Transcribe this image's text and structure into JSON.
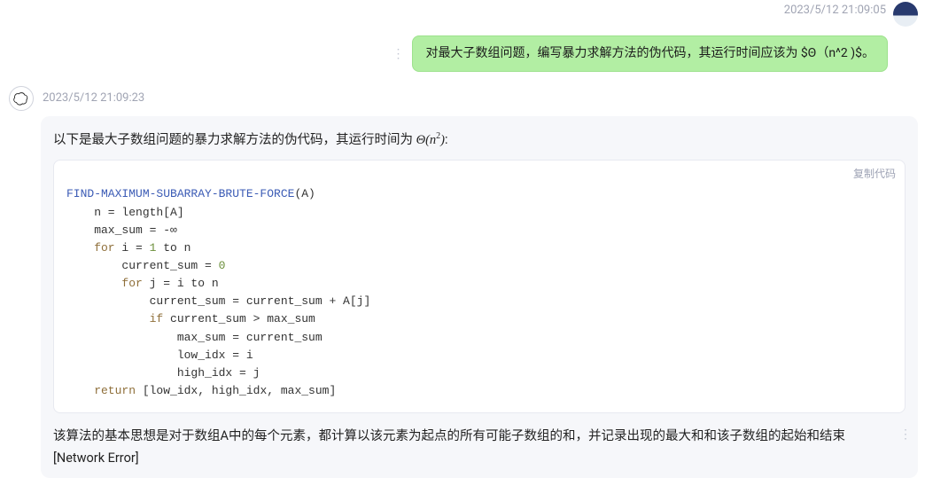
{
  "user": {
    "timestamp": "2023/5/12 21:09:05",
    "message": "对最大子数组问题，编写暴力求解方法的伪代码，其运行时间应该为 $Θ（n^2 )$。"
  },
  "assistant": {
    "timestamp": "2023/5/12 21:09:23",
    "intro_pre": "以下是最大子数组问题的暴力求解方法的伪代码，其运行时间为 ",
    "intro_math_theta": "Θ(n",
    "intro_math_sup": "2",
    "intro_math_close": ")",
    "intro_post": ":",
    "copy_label": "复制代码",
    "code": {
      "l1_fn": "FIND-MAXIMUM-SUBARRAY-BRUTE-FORCE",
      "l1_arg": "(A)",
      "l2": "    n = length[A]",
      "l3": "    max_sum = -∞",
      "l4_kw": "    for",
      "l4_rest1": " i = ",
      "l4_num": "1",
      "l4_rest2": " to n",
      "l5_pre": "        current_sum = ",
      "l5_num": "0",
      "l6_kw": "        for",
      "l6_rest": " j = i to n",
      "l7": "            current_sum = current_sum + A[j]",
      "l8_kw": "            if",
      "l8_rest": " current_sum > max_sum",
      "l9": "                max_sum = current_sum",
      "l10": "                low_idx = i",
      "l11": "                high_idx = j",
      "l12_kw": "    return",
      "l12_rest": " [low_idx, high_idx, max_sum]"
    },
    "explanation": "该算法的基本思想是对于数组A中的每个元素，都计算以该元素为起点的所有可能子数组的和，并记录出现的最大和和该子数组的起始和结束",
    "network_error": "[Network Error]"
  }
}
